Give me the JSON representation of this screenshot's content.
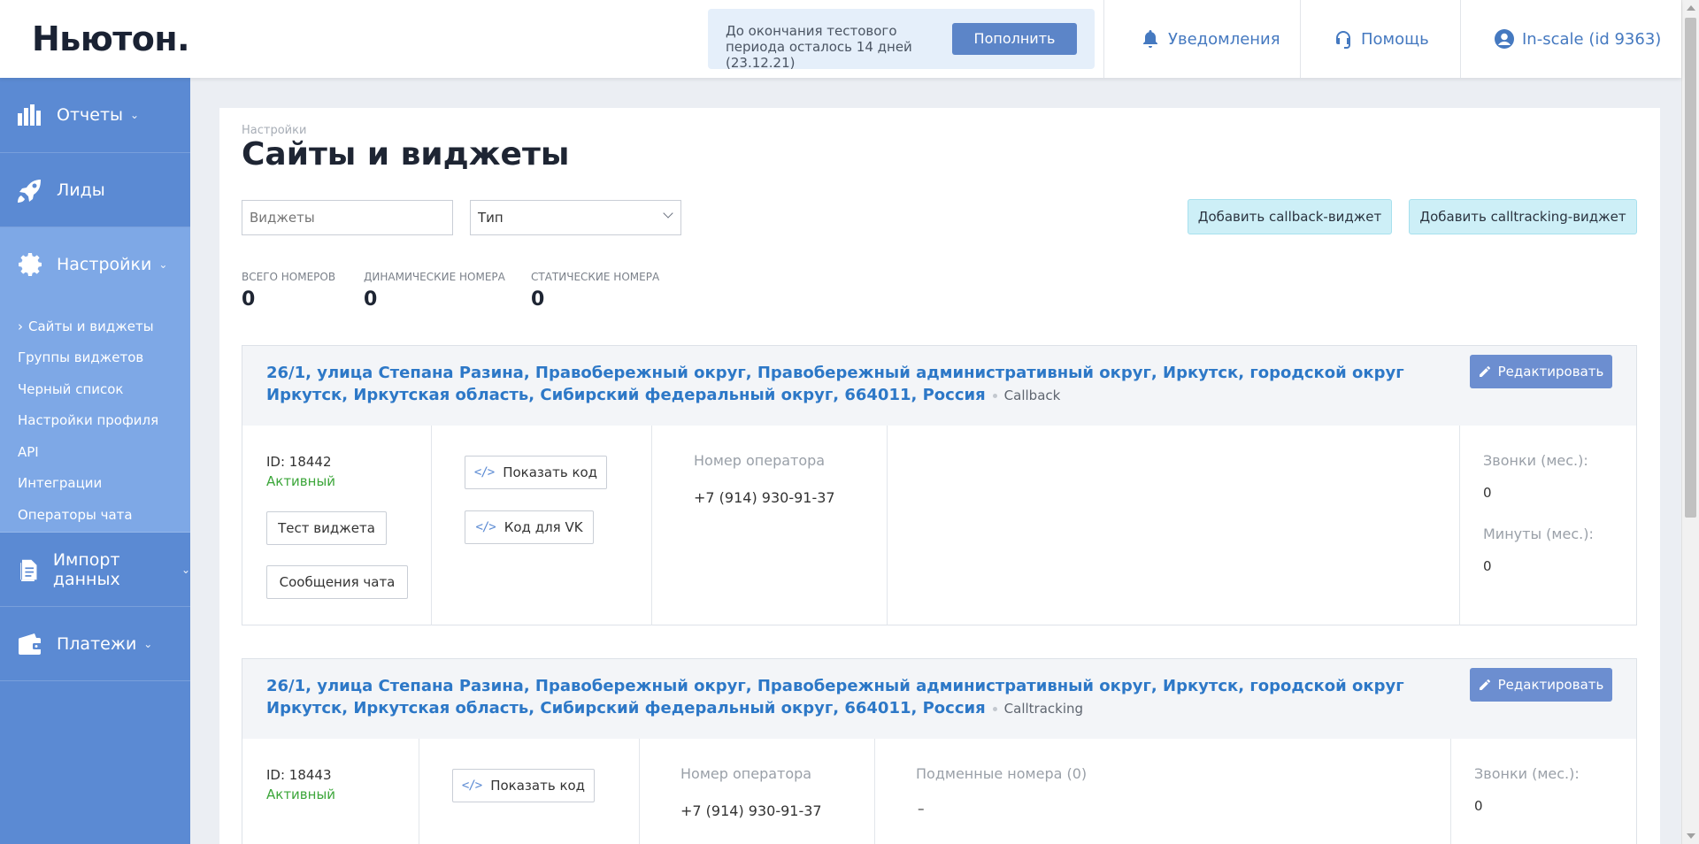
{
  "header": {
    "logo": "Ньютон.",
    "trial_text": "До окончания тестового периода осталось 14 дней (23.12.21)",
    "topup_label": "Пополнить",
    "notifications_label": "Уведомления",
    "help_label": "Помощь",
    "account_label": "In-scale (id 9363)"
  },
  "sidebar": {
    "reports": "Отчеты",
    "leads": "Лиды",
    "settings": "Настройки",
    "sub_items": [
      "Сайты и виджеты",
      "Группы виджетов",
      "Черный список",
      "Настройки профиля",
      "API",
      "Интеграции",
      "Операторы чата"
    ],
    "import": "Импорт данных",
    "payments": "Платежи"
  },
  "main": {
    "breadcrumb": "Настройки",
    "title": "Сайты и виджеты",
    "search_placeholder": "Виджеты",
    "type_select": "Тип",
    "add_callback": "Добавить callback-виджет",
    "add_calltracking": "Добавить calltracking-виджет",
    "stats": [
      {
        "label": "Всего номеров",
        "value": "0"
      },
      {
        "label": "Динамические номера",
        "value": "0"
      },
      {
        "label": "Статические номера",
        "value": "0"
      }
    ]
  },
  "widgets": [
    {
      "address": "26/1, улица Степана Разина, Правобережный округ, Правобережный административный округ, Иркутск, городской округ Иркутск, Иркутская область, Сибирский федеральный округ, 664011, Россия",
      "type": "Callback",
      "edit_label": "Редактировать",
      "id": "ID: 18442",
      "status": "Активный",
      "test_btn": "Тест виджета",
      "chat_btn": "Сообщения чата",
      "show_code": "Показать код",
      "vk_code": "Код для VK",
      "operator_label": "Номер оператора",
      "operator_phone": "+7 (914) 930-91-37",
      "calls_label": "Звонки (мес.):",
      "calls_value": "0",
      "minutes_label": "Минуты (мес.):",
      "minutes_value": "0"
    },
    {
      "address": "26/1, улица Степана Разина, Правобережный округ, Правобережный административный округ, Иркутск, городской округ Иркутск, Иркутская область, Сибирский федеральный округ, 664011, Россия",
      "type": "Calltracking",
      "edit_label": "Редактировать",
      "id": "ID: 18443",
      "status": "Активный",
      "show_code": "Показать код",
      "operator_label": "Номер оператора",
      "operator_phone": "+7 (914) 930-91-37",
      "substitute_label": "Подменные номера (0)",
      "substitute_value": "–",
      "calls_label": "Звонки (мес.):",
      "calls_value": "0"
    }
  ]
}
